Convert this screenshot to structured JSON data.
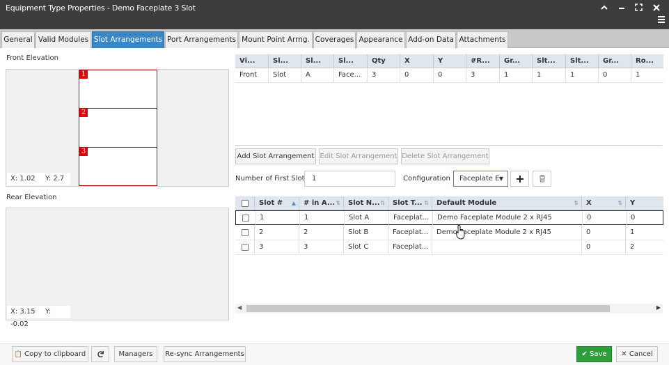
{
  "window": {
    "title": "Equipment Type Properties - Demo Faceplate 3 Slot",
    "controls": [
      "chevron-up-icon",
      "minimize-icon",
      "maximize-icon",
      "close-icon"
    ]
  },
  "tabs": [
    {
      "label": "General"
    },
    {
      "label": "Valid Modules"
    },
    {
      "label": "Slot Arrangements",
      "active": true
    },
    {
      "label": "Port Arrangements"
    },
    {
      "label": "Mount Point Arrng."
    },
    {
      "label": "Coverages"
    },
    {
      "label": "Appearance"
    },
    {
      "label": "Add-on Data"
    },
    {
      "label": "Attachments"
    }
  ],
  "front_elevation": {
    "label": "Front Elevation",
    "slots": [
      "1",
      "2",
      "3"
    ],
    "coord_x": "X: 1.02",
    "coord_y": "Y: 2.7"
  },
  "rear_elevation": {
    "label": "Rear Elevation",
    "coord_x": "X: 3.15",
    "coord_y": "Y: -0.02"
  },
  "arrangement_grid": {
    "columns": [
      "Vi...",
      "Sl...",
      "Sl...",
      "Sl...",
      "Qty",
      "X",
      "Y",
      "#R...",
      "Gr...",
      "Slt...",
      "Slt...",
      "Gr...",
      "Ro..."
    ],
    "rows": [
      [
        "Front",
        "Slot",
        "A",
        "Face...",
        "3",
        "0",
        "0",
        "3",
        "1",
        "1",
        "1",
        "0",
        "1"
      ]
    ]
  },
  "arrangement_buttons": {
    "add": "Add Slot Arrangement",
    "edit": "Edit Slot Arrangement",
    "delete": "Delete Slot Arrangement"
  },
  "form": {
    "first_slot_label": "Number of First Slot",
    "first_slot_value": "1",
    "configuration_label": "Configuration",
    "configuration_value": "Faceplate E"
  },
  "slot_grid": {
    "columns": [
      "Slot #",
      "# in A...",
      "Slot N...",
      "Slot T...",
      "Default Module",
      "X",
      "Y"
    ],
    "rows": [
      {
        "checked": false,
        "cells": [
          "1",
          "1",
          "Slot A",
          "Faceplat...",
          "Demo Faceplate Module 2 x RJ45",
          "0",
          "0"
        ]
      },
      {
        "checked": false,
        "cells": [
          "2",
          "2",
          "Slot B",
          "Faceplat...",
          "Demo Faceplate Module 2 x RJ45",
          "0",
          "1"
        ]
      },
      {
        "checked": false,
        "cells": [
          "3",
          "3",
          "Slot C",
          "Faceplat...",
          "",
          "0",
          "2"
        ]
      }
    ]
  },
  "footer": {
    "copy": "Copy to clipboard",
    "managers": "Managers",
    "resync": "Re-sync Arrangements",
    "save": "Save",
    "cancel": "Cancel"
  },
  "colors": {
    "accent": "#3a87c8",
    "titlebar": "#3d3d3d",
    "save": "#2e9e3a",
    "slot_number": "#e00000"
  }
}
